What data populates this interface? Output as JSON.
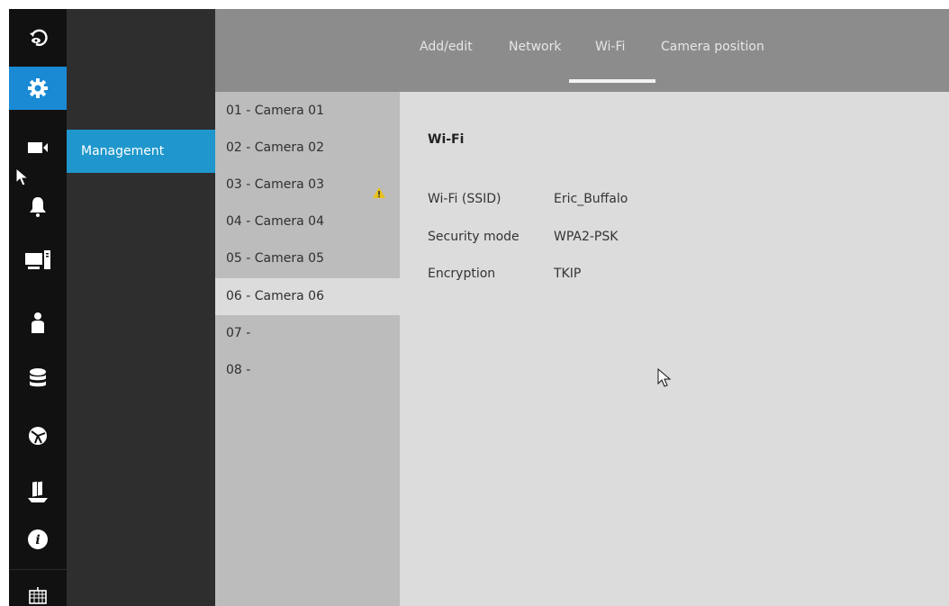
{
  "top_tabs": [
    "Add/edit",
    "Network",
    "Wi-Fi",
    "Camera position"
  ],
  "active_tab": "Wi-Fi",
  "sidebar": {
    "active_icon": "settings-gear-icon",
    "icons": [
      "playback-icon",
      "settings-gear-icon",
      "camera-icon",
      "bell-icon",
      "monitor-icon",
      "user-icon",
      "storage-icon",
      "network-globe-icon",
      "backup-icon",
      "info-icon",
      "keyboard-icon"
    ],
    "submenu": {
      "item": "Management"
    }
  },
  "cameras": [
    {
      "label": "01 - Camera 01",
      "warning": false
    },
    {
      "label": "02 - Camera 02",
      "warning": false
    },
    {
      "label": "03 - Camera 03",
      "warning": true
    },
    {
      "label": "04 - Camera 04",
      "warning": false
    },
    {
      "label": "05 - Camera 05",
      "warning": false
    },
    {
      "label": "06 - Camera 06",
      "warning": false
    },
    {
      "label": "07 -",
      "warning": false
    },
    {
      "label": "08 -",
      "warning": false
    }
  ],
  "selected_camera": "06 - Camera 06",
  "wifi": {
    "title": "Wi-Fi",
    "ssid_label": "Wi-Fi (SSID)",
    "ssid_value": "Eric_Buffalo",
    "security_label": "Security mode",
    "security_value": "WPA2-PSK",
    "encryption_label": "Encryption",
    "encryption_value": "TKIP"
  },
  "colors": {
    "accent": "#1a8ad4",
    "submenu_active": "#1f97cc",
    "warning": "#e8c21b"
  }
}
